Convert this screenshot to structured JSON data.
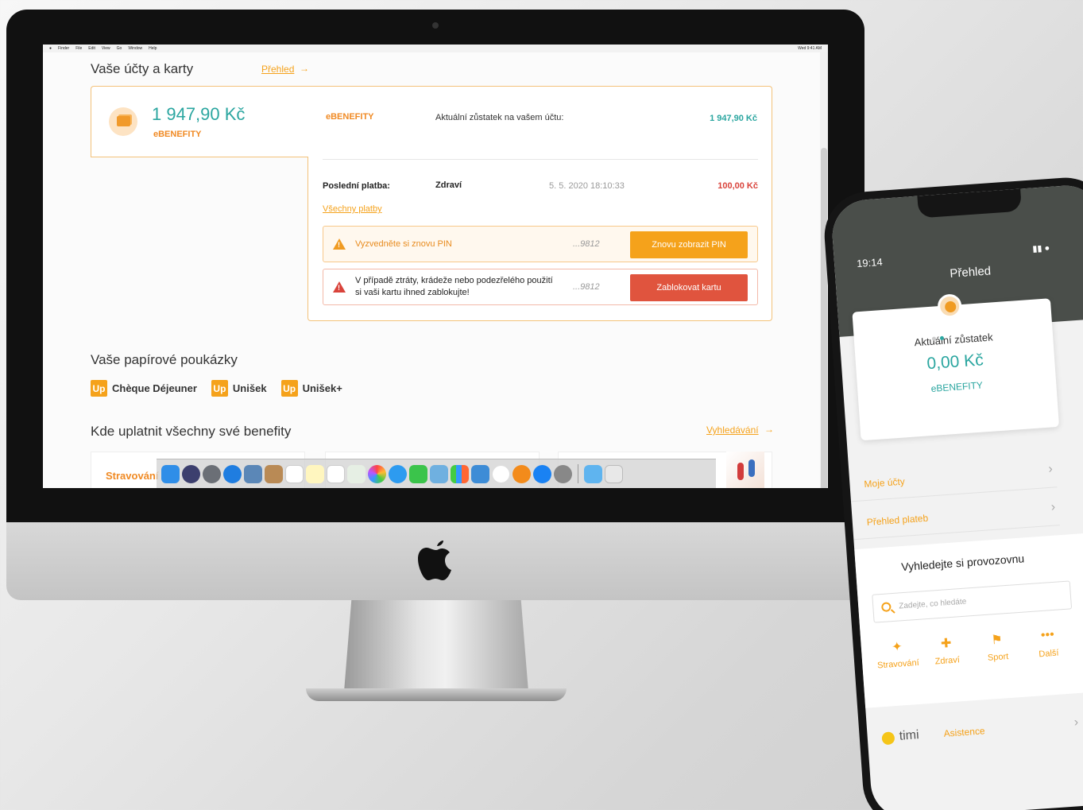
{
  "menubar": {
    "items": [
      "Finder",
      "File",
      "Edit",
      "View",
      "Go",
      "Window",
      "Help"
    ],
    "right": "Wed 9:41 AM"
  },
  "desktop": {
    "accounts_title": "Vaše účty a karty",
    "overview_link": "Přehled",
    "account": {
      "amount": "1 947,90 Kč",
      "name": "eBENEFITY",
      "col_name": "eBENEFITY",
      "balance_label": "Aktuální zůstatek na vašem účtu:",
      "balance_value": "1 947,90 Kč"
    },
    "last_payment": {
      "label": "Poslední platba:",
      "category": "Zdraví",
      "date": "5. 5. 2020 18:10:33",
      "amount": "100,00 Kč"
    },
    "all_payments_link": "Všechny platby",
    "alerts": [
      {
        "text": "Vyzvedněte si znovu PIN",
        "card": "...9812",
        "button": "Znovu zobrazit PIN"
      },
      {
        "text_line1": "V případě ztráty, krádeže nebo podezřelého použití",
        "text_line2": "si vaši kartu ihned zablokujte!",
        "card": "...9812",
        "button": "Zablokovat kartu"
      }
    ],
    "vouchers_title": "Vaše papírové poukázky",
    "vouchers": [
      {
        "logo": "Up",
        "name": "Chèque Déjeuner"
      },
      {
        "logo": "Up",
        "name": "Unišek"
      },
      {
        "logo": "Up",
        "name": "Unišek+"
      }
    ],
    "benefits_title": "Kde uplatnit všechny své benefity",
    "search_link": "Vyhledávání",
    "tile_label": "Stravování"
  },
  "phone": {
    "time": "19:14",
    "title": "Přehled",
    "balance_label": "Aktuální zůstatek",
    "balance_amount": "0,00 Kč",
    "balance_name": "eBENEFITY",
    "menu": [
      {
        "label": "Moje účty"
      },
      {
        "label": "Přehled plateb"
      }
    ],
    "search_title": "Vyhledejte si provozovnu",
    "search_placeholder": "Zadejte, co hledáte",
    "categories": [
      {
        "label": "Stravování",
        "icon": "fork-knife-icon"
      },
      {
        "label": "Zdraví",
        "icon": "plus-icon"
      },
      {
        "label": "Sport",
        "icon": "golf-icon"
      },
      {
        "label": "Další",
        "icon": "more-icon"
      }
    ],
    "timi_brand": "timi",
    "assistance": "Asistence"
  },
  "colors": {
    "accent": "#f5a21b",
    "teal": "#2ba6a0",
    "danger": "#e0543e",
    "phone_header": "#4a4e4a"
  }
}
